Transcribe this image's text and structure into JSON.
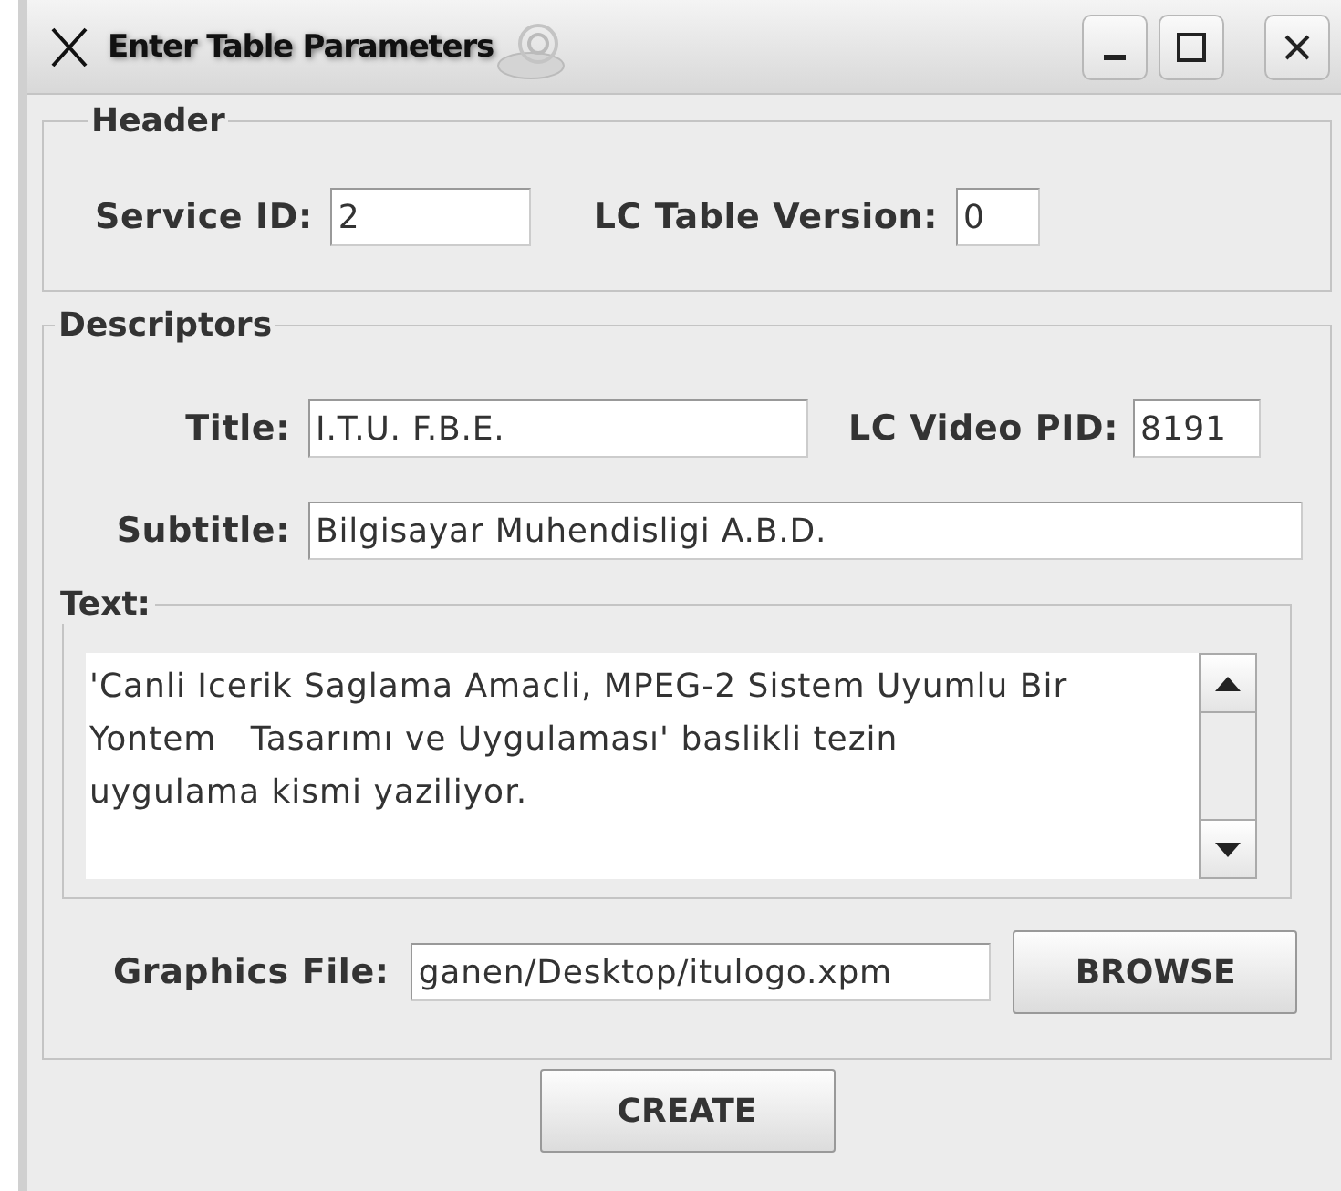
{
  "window": {
    "title": "Enter Table Parameters"
  },
  "header": {
    "legend": "Header",
    "fields": [
      {
        "label": "Service ID:",
        "value": "2"
      },
      {
        "label": "LC Table Version:",
        "value": "0"
      }
    ]
  },
  "descriptors": {
    "legend": "Descriptors",
    "title": {
      "label": "Title:",
      "value": "I.T.U. F.B.E."
    },
    "video_pid": {
      "label": "LC Video PID:",
      "value": "8191"
    },
    "subtitle": {
      "label": "Subtitle:",
      "value": "Bilgisayar Muhendisligi A.B.D."
    },
    "text": {
      "legend": "Text:",
      "value": "'Canli Icerik Saglama Amacli, MPEG-2 Sistem Uyumlu Bir\nYontem   Tasarımı ve Uygulaması' baslikli tezin\nuygulama kismi yaziliyor."
    },
    "graphics_file": {
      "label": "Graphics File:",
      "value": "ganen/Desktop/itulogo.xpm"
    },
    "browse_button": "BROWSE"
  },
  "create_button": "CREATE"
}
